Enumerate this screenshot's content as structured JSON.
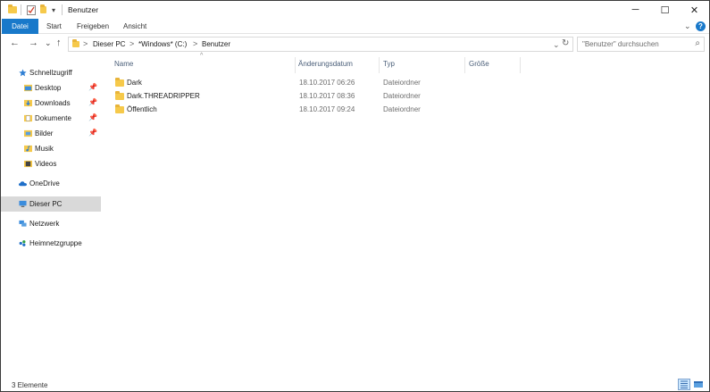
{
  "window": {
    "title": "Benutzer",
    "controls": {
      "minimize": "─",
      "maximize": "☐",
      "close": "✕"
    }
  },
  "ribbon": {
    "tabs": [
      "Datei",
      "Start",
      "Freigeben",
      "Ansicht"
    ],
    "expand_glyph": "⌄",
    "help_glyph": "?"
  },
  "navigation": {
    "back": "←",
    "forward": "→",
    "recent": "⌄",
    "up": "↑",
    "breadcrumbs": [
      "Dieser PC",
      "*Windows* (C:)",
      "Benutzer"
    ],
    "crumb_separator": ">",
    "dropdown": "⌄",
    "refresh": "↻",
    "search_placeholder": "\"Benutzer\" durchsuchen",
    "search_icon": "⌕"
  },
  "sidebar": {
    "quick_access": "Schnellzugriff",
    "quick_items": [
      {
        "label": "Desktop",
        "icon": "desktop-icon",
        "pinned": true
      },
      {
        "label": "Downloads",
        "icon": "downloads-icon",
        "pinned": true
      },
      {
        "label": "Dokumente",
        "icon": "documents-icon",
        "pinned": true
      },
      {
        "label": "Bilder",
        "icon": "pictures-icon",
        "pinned": true
      },
      {
        "label": "Musik",
        "icon": "music-icon",
        "pinned": false
      },
      {
        "label": "Videos",
        "icon": "videos-icon",
        "pinned": false
      }
    ],
    "onedrive": "OneDrive",
    "this_pc": "Dieser PC",
    "network": "Netzwerk",
    "homegroup": "Heimnetzgruppe"
  },
  "columns": {
    "name": "Name",
    "date": "Änderungsdatum",
    "type": "Typ",
    "size": "Größe"
  },
  "files": [
    {
      "name": "Dark",
      "date": "18.10.2017 06:26",
      "type": "Dateiordner"
    },
    {
      "name": "Dark.THREADRIPPER",
      "date": "18.10.2017 08:36",
      "type": "Dateiordner"
    },
    {
      "name": "Öffentlich",
      "date": "18.10.2017 09:24",
      "type": "Dateiordner"
    }
  ],
  "status": {
    "count": "3 Elemente"
  },
  "colors": {
    "accent": "#1979ca",
    "folder": "#f6c94a",
    "selection": "#d9d9d9"
  }
}
